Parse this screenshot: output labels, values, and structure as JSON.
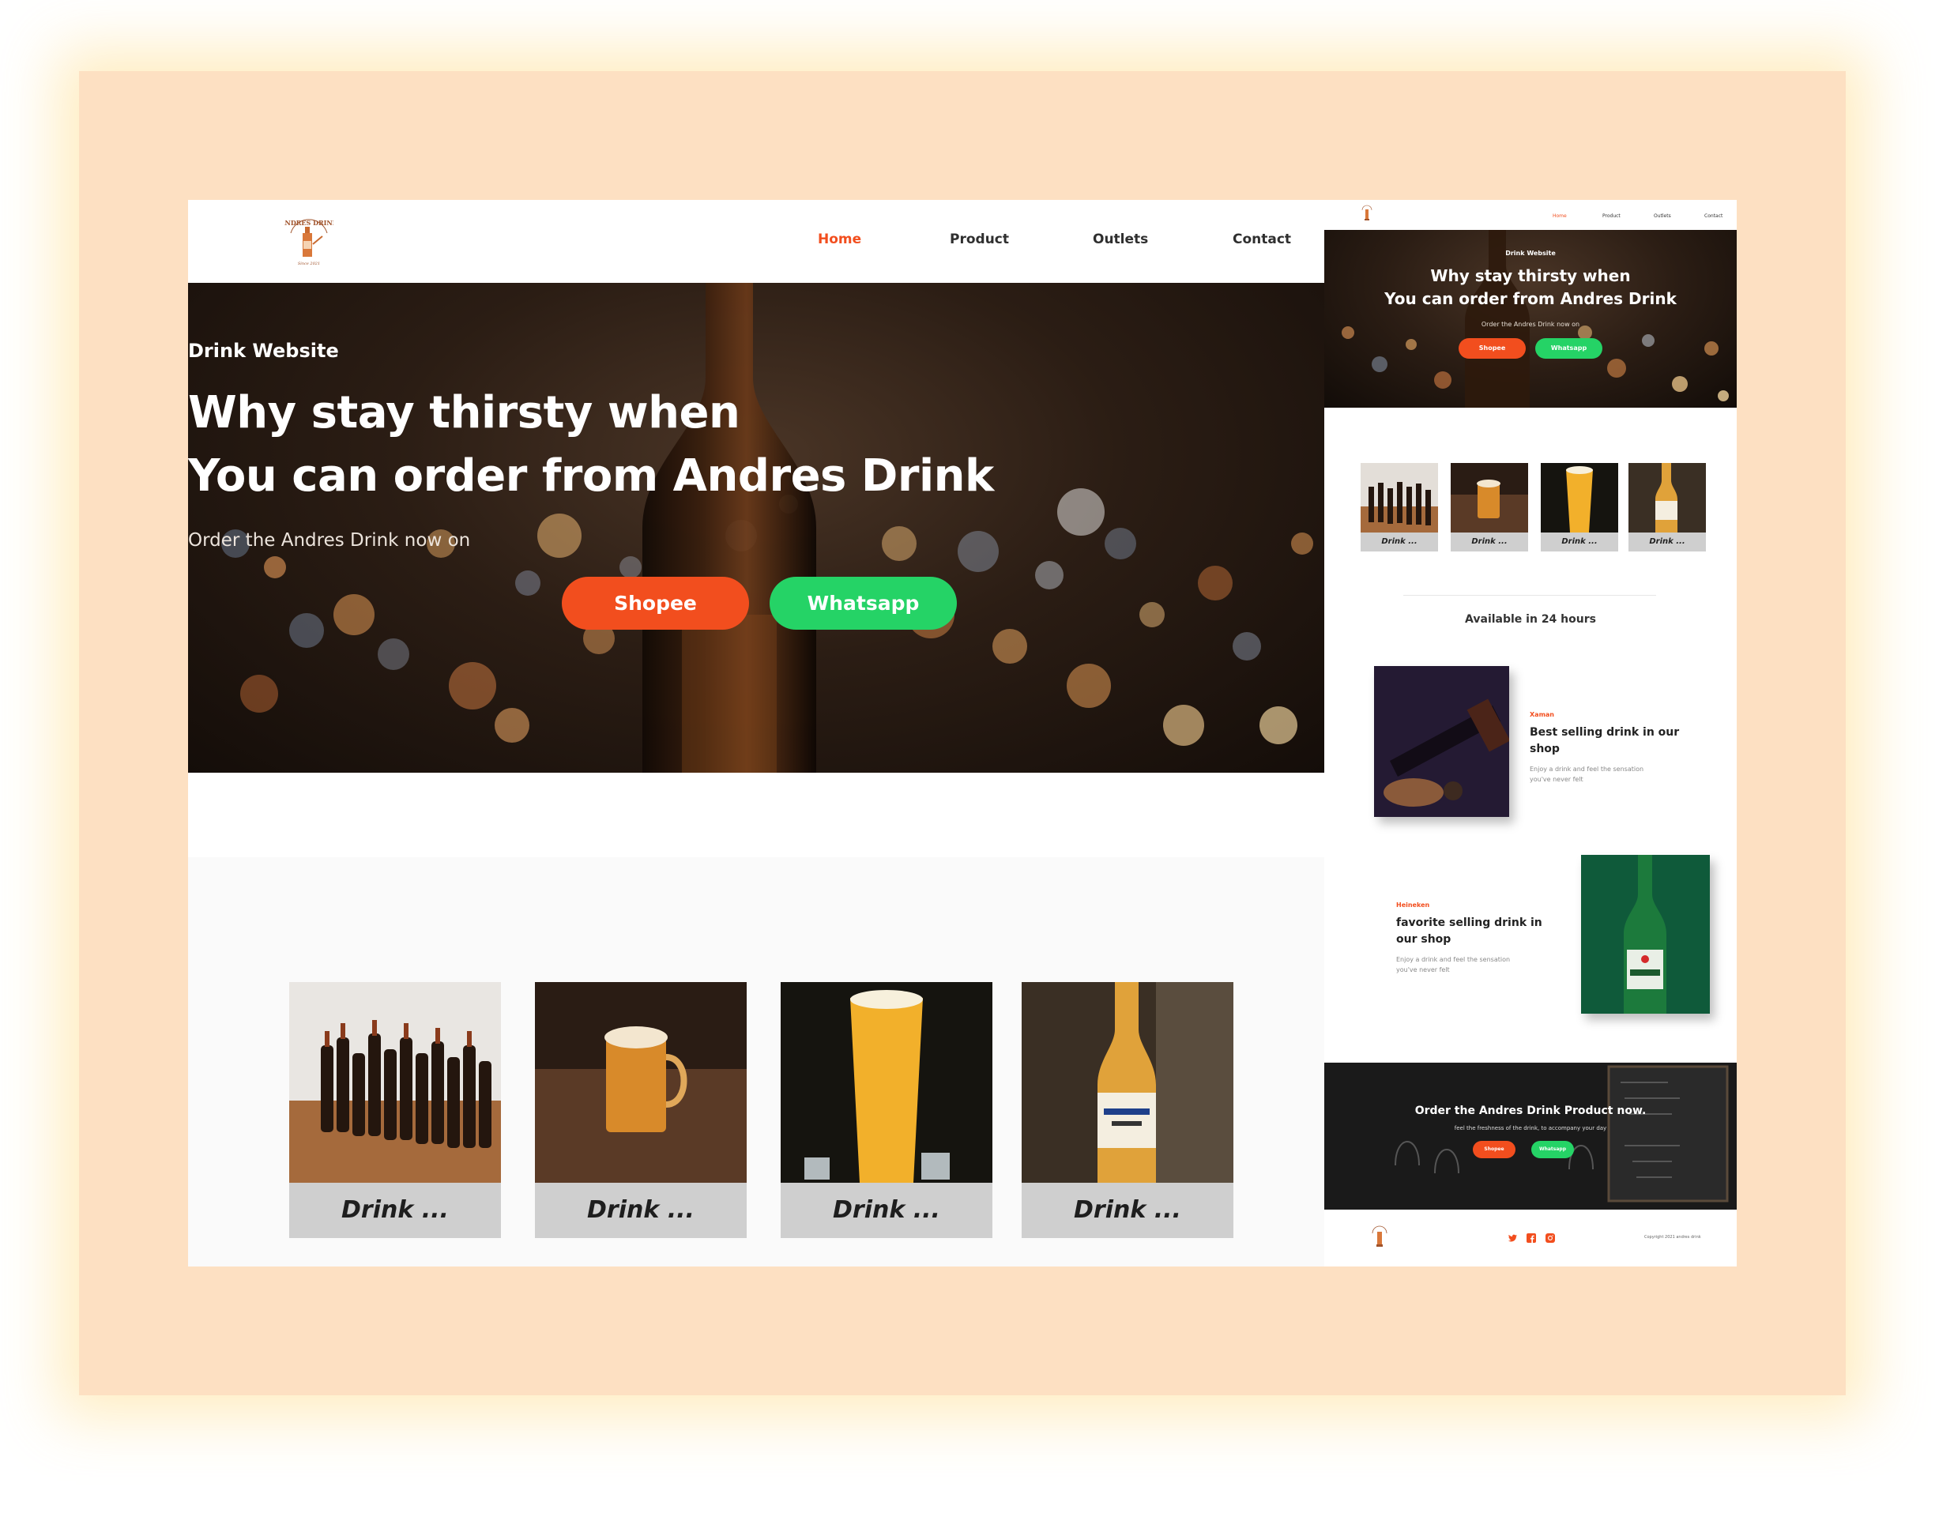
{
  "desktop": {
    "nav": {
      "items": [
        {
          "label": "Home",
          "active": true
        },
        {
          "label": "Product",
          "active": false
        },
        {
          "label": "Outlets",
          "active": false
        },
        {
          "label": "Contact",
          "active": false
        }
      ]
    },
    "hero": {
      "subtitle": "Drink Website",
      "title_line1": "Why stay thirsty when",
      "title_line2": "You can order from Andres Drink",
      "description": "Order the Andres Drink now on",
      "shopee_label": "Shopee",
      "whatsapp_label": "Whatsapp"
    },
    "products": [
      {
        "label": "Drink ...",
        "image": "beer-bottles-photo"
      },
      {
        "label": "Drink ...",
        "image": "beer-mug-photo"
      },
      {
        "label": "Drink ...",
        "image": "beer-glass-photo"
      },
      {
        "label": "Drink ...",
        "image": "corona-bottle-photo"
      }
    ]
  },
  "mobile": {
    "nav": {
      "items": [
        {
          "label": "Home",
          "active": true
        },
        {
          "label": "Product",
          "active": false
        },
        {
          "label": "Outlets",
          "active": false
        },
        {
          "label": "Contact",
          "active": false
        }
      ]
    },
    "hero": {
      "subtitle": "Drink Website",
      "title_line1": "Why stay thirsty when",
      "title_line2": "You can order from Andres Drink",
      "description": "Order the Andres Drink now on",
      "shopee_label": "Shopee",
      "whatsapp_label": "Whatsapp"
    },
    "thumbs": [
      {
        "label": "Drink ..."
      },
      {
        "label": "Drink ..."
      },
      {
        "label": "Drink ..."
      },
      {
        "label": "Drink ..."
      }
    ],
    "availability": "Available in 24 hours",
    "features": [
      {
        "brand": "Xaman",
        "title": "Best selling drink in our shop",
        "description": "Enjoy a drink and feel the sensation you've never felt"
      },
      {
        "brand": "Heineken",
        "title": "favorite selling drink in our shop",
        "description": "Enjoy a drink and feel the sensation you've never felt"
      }
    ],
    "cta": {
      "title": "Order the Andres Drink Product now.",
      "description": "feel the freshness of the drink, to accompany your day",
      "shopee_label": "Shopee",
      "whatsapp_label": "Whatsapp"
    },
    "footer": {
      "social_icons": [
        "twitter-icon",
        "facebook-icon",
        "instagram-icon"
      ],
      "copyright": "Copyright 2021 andres drink"
    }
  },
  "colors": {
    "accent": "#f24e1e",
    "whatsapp": "#25d366",
    "frame_bg": "#fde0c2",
    "text_dark": "#2f2f2f",
    "card_label_bg": "#cfcfcf"
  }
}
